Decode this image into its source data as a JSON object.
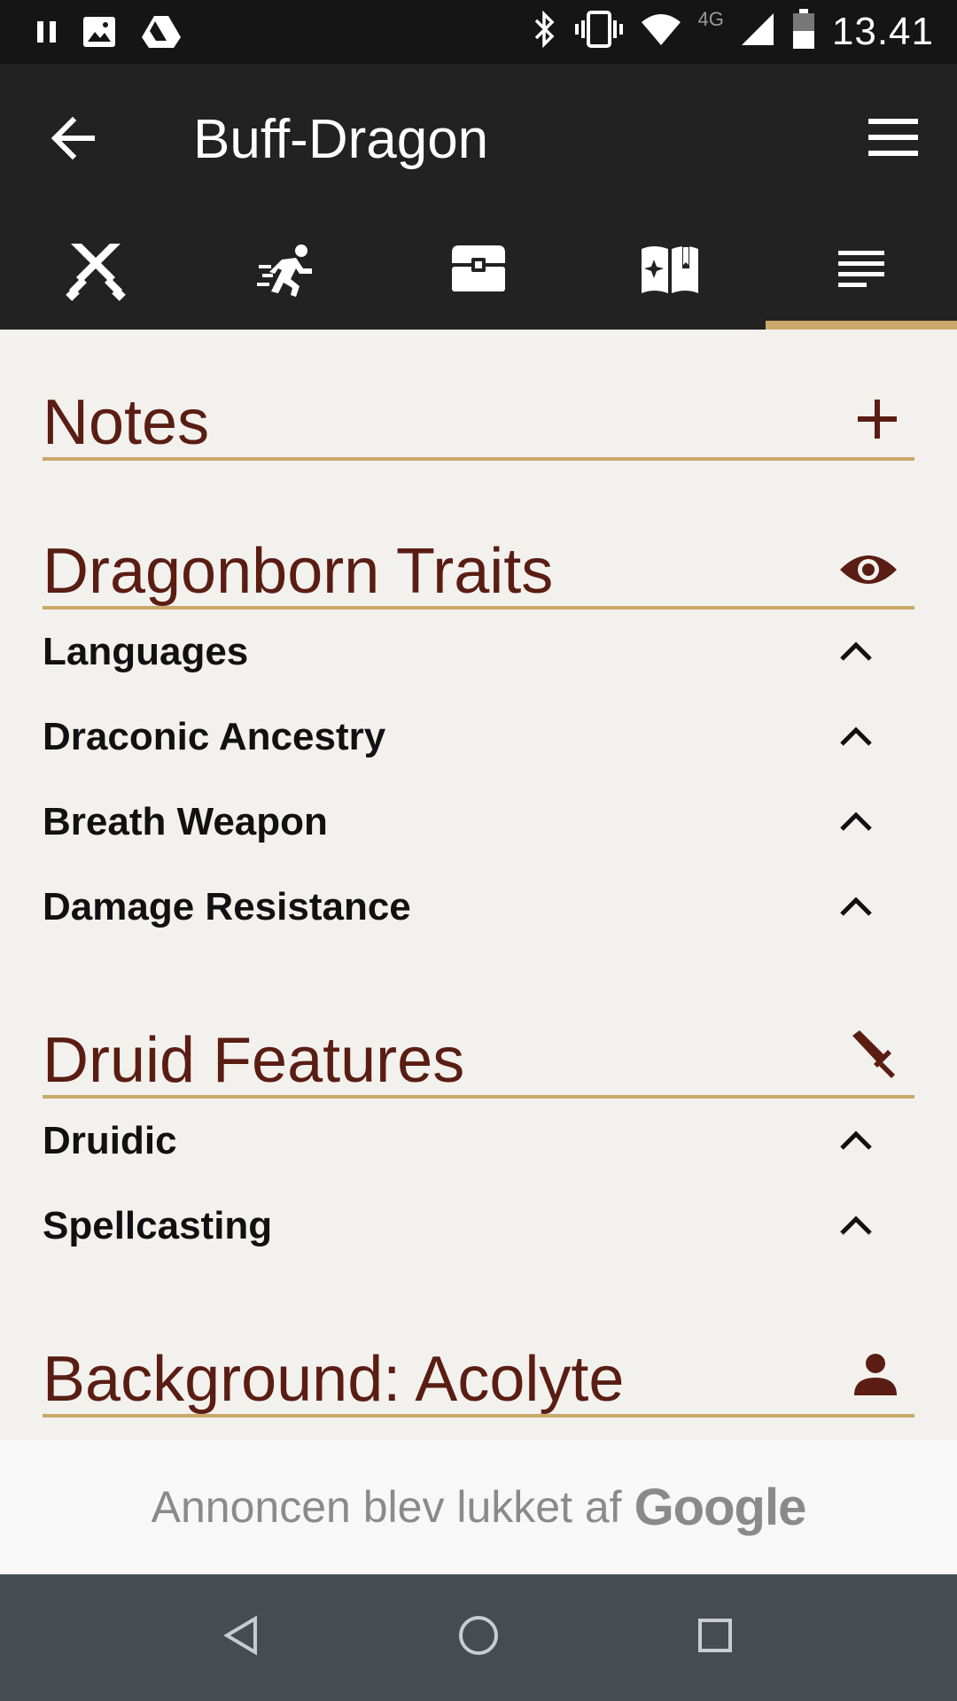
{
  "status_bar": {
    "time": "13.41",
    "network_label": "4G",
    "icons_left": [
      "pause-icon",
      "image-icon",
      "drive-icon"
    ],
    "icons_right": [
      "bluetooth-icon",
      "vibrate-icon",
      "wifi-icon",
      "signal-icon",
      "battery-icon"
    ]
  },
  "app_bar": {
    "title": "Buff-Dragon",
    "back_icon": "arrow-left-icon",
    "menu_icon": "hamburger-menu-icon"
  },
  "tabs": [
    {
      "icon": "crossed-swords-icon",
      "active": false
    },
    {
      "icon": "running-figure-icon",
      "active": false
    },
    {
      "icon": "treasure-chest-icon",
      "active": false
    },
    {
      "icon": "spellbook-icon",
      "active": false
    },
    {
      "icon": "notes-lines-icon",
      "active": true
    }
  ],
  "sections": {
    "notes": {
      "title": "Notes",
      "icon": "plus-icon"
    },
    "dragonborn": {
      "title": "Dragonborn Traits",
      "icon": "eye-icon",
      "items": [
        {
          "label": "Languages"
        },
        {
          "label": "Draconic Ancestry"
        },
        {
          "label": "Breath Weapon"
        },
        {
          "label": "Damage Resistance"
        }
      ]
    },
    "druid": {
      "title": "Druid Features",
      "icon": "sword-icon",
      "items": [
        {
          "label": "Druidic"
        },
        {
          "label": "Spellcasting"
        }
      ]
    },
    "background": {
      "title": "Background: Acolyte",
      "icon": "person-icon"
    }
  },
  "ad": {
    "text": "Annoncen blev lukket af",
    "brand": "Google"
  },
  "colors": {
    "accent_gold": "#c9a86a",
    "heading_maroon": "#5a1d14",
    "appbar_dark": "#222222",
    "page_background": "#f3f1ed"
  }
}
